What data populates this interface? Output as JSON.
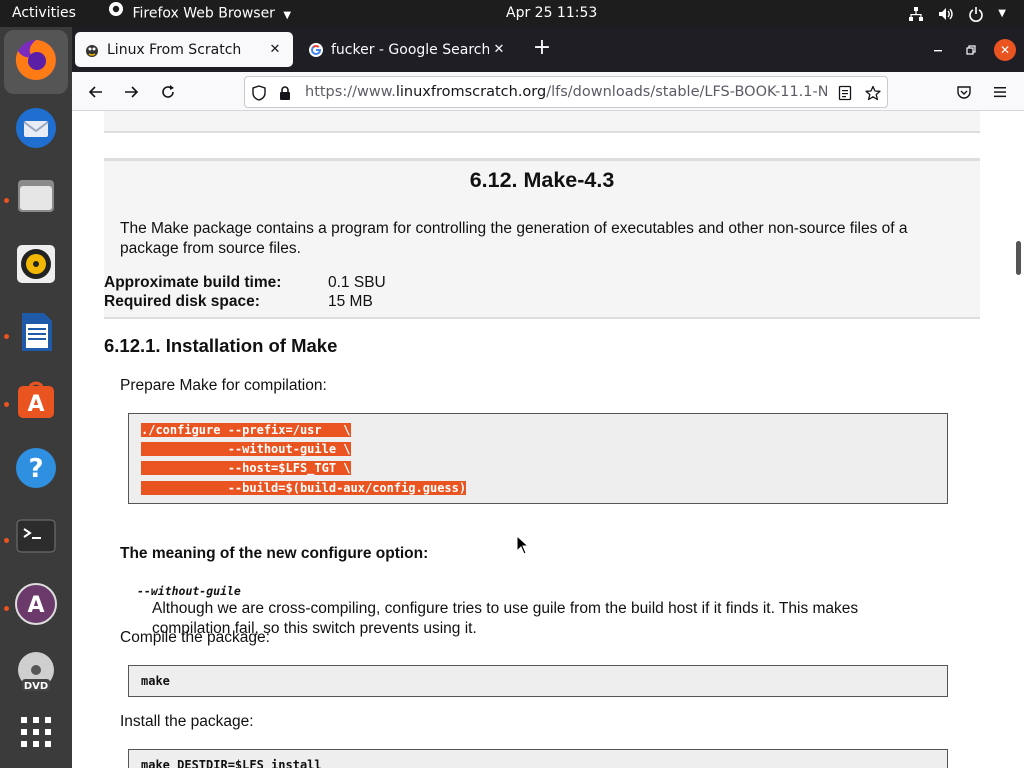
{
  "topbar": {
    "activities": "Activities",
    "app_menu": "Firefox Web Browser",
    "clock": "Apr 25  11:53",
    "tray_icons": [
      "network-icon",
      "volume-icon",
      "power-icon",
      "chevron-down-icon"
    ]
  },
  "dock": {
    "items": [
      {
        "name": "Firefox",
        "icon": "firefox-icon",
        "running": true,
        "active": true
      },
      {
        "name": "Thunderbird",
        "icon": "thunderbird-icon",
        "running": false
      },
      {
        "name": "Files",
        "icon": "files-icon",
        "running": true
      },
      {
        "name": "Rhythmbox",
        "icon": "rhythmbox-icon",
        "running": false
      },
      {
        "name": "LibreOffice Writer",
        "icon": "writer-icon",
        "running": true
      },
      {
        "name": "Ubuntu Software",
        "icon": "software-icon",
        "running": true
      },
      {
        "name": "Help",
        "icon": "help-icon",
        "running": false
      },
      {
        "name": "Terminal",
        "icon": "terminal-icon",
        "running": true
      },
      {
        "name": "Software Updater",
        "icon": "updater-icon",
        "running": true
      },
      {
        "name": "DVD",
        "icon": "dvd-icon",
        "running": false
      },
      {
        "name": "Show Applications",
        "icon": "app-grid-icon",
        "running": false
      }
    ]
  },
  "browser": {
    "tabs": [
      {
        "title": "Linux From Scratch",
        "active": true
      },
      {
        "title": "fucker - Google Search",
        "active": false
      }
    ],
    "url_prefix": "https://www.",
    "url_domain": "linuxfromscratch.org",
    "url_path": "/lfs/downloads/stable/LFS-BOOK-11.1-N"
  },
  "page": {
    "package_title": "6.12. Make-4.3",
    "package_desc": "The Make package contains a program for controlling the generation of executables and other non-source files of a package from source files.",
    "build_time_label": "Approximate build time:",
    "build_time_value": "0.1 SBU",
    "disk_space_label": "Required disk space:",
    "disk_space_value": "15 MB",
    "section_title": "6.12.1. Installation of Make",
    "prepare_text": "Prepare Make for compilation:",
    "configure_lines": [
      "./configure --prefix=/usr   \\",
      "            --without-guile \\",
      "            --host=$LFS_TGT \\",
      "            --build=$(build-aux/config.guess)"
    ],
    "option_title": "The meaning of the new configure option:",
    "option_term": "--without-guile",
    "option_desc": "Although we are cross-compiling, configure tries to use guile from the build host if it finds it. This makes compilation fail, so this switch prevents using it.",
    "compile_text": "Compile the package:",
    "compile_cmd": "make",
    "install_text": "Install the package:",
    "install_cmd": "make DESTDIR=$LFS install"
  },
  "colors": {
    "accent": "#e95420",
    "selection": "#e95420",
    "topbar": "#1d1d1d",
    "dock": "#3b3b3b"
  }
}
